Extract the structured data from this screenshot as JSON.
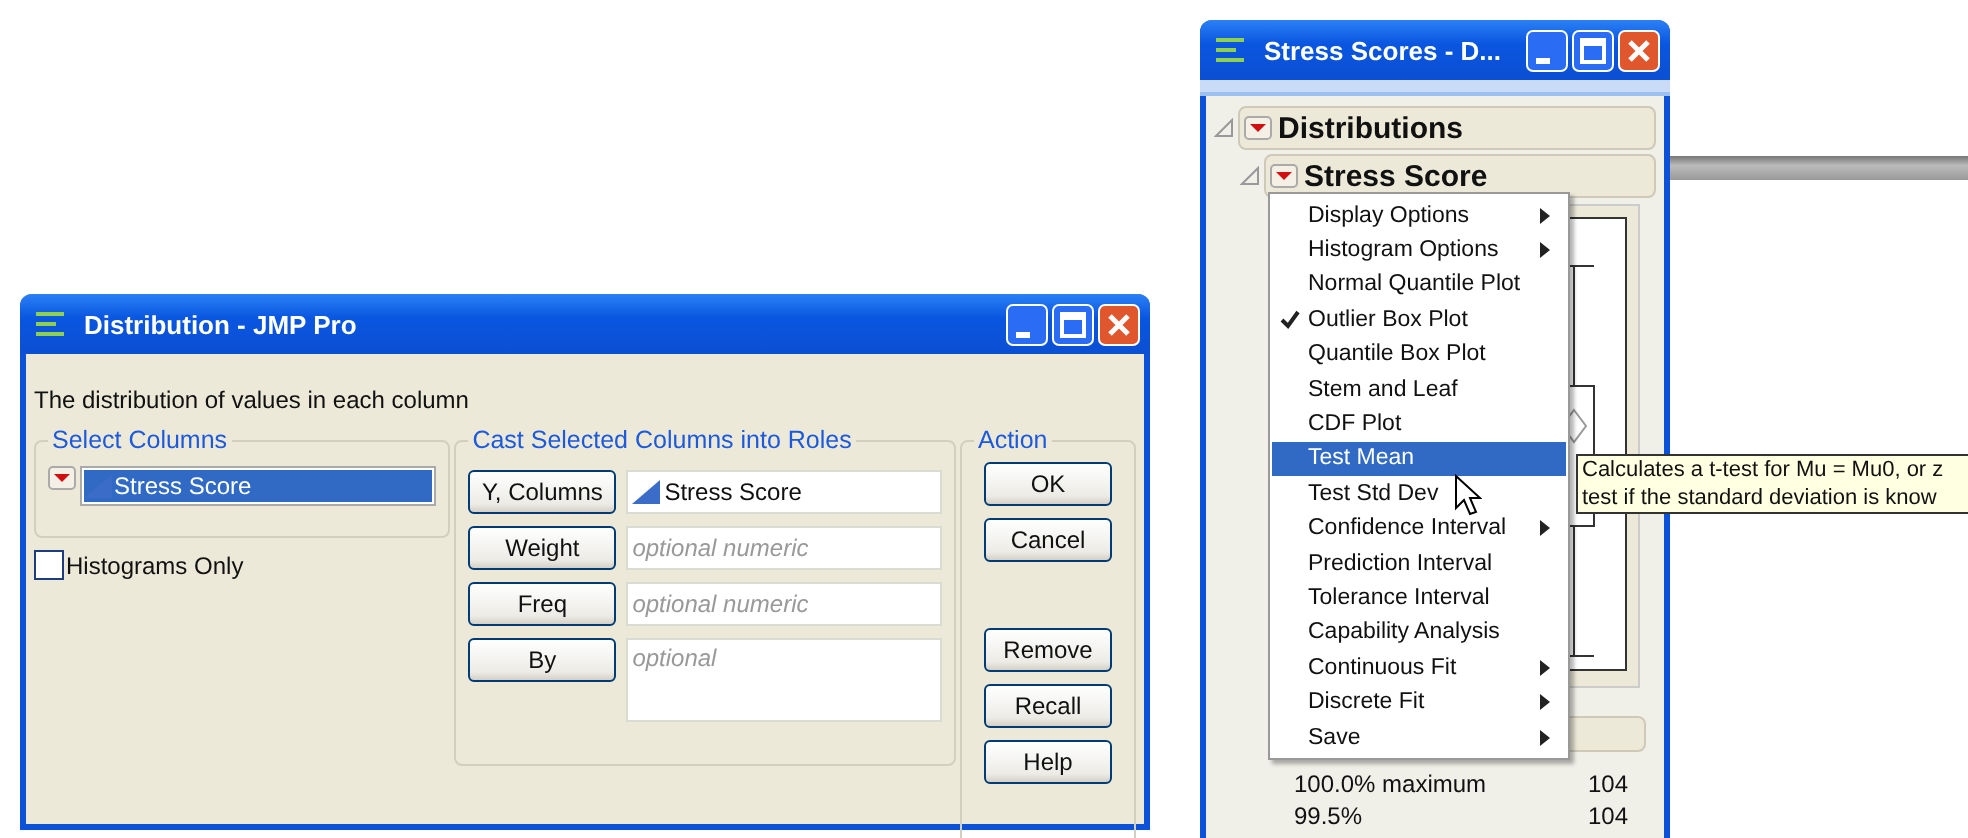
{
  "dialog": {
    "title": "Distribution - JMP Pro",
    "description": "The distribution of values in each column",
    "select_columns": {
      "title": "Select Columns",
      "columns": [
        {
          "name": "Stress Score",
          "selected": true
        }
      ]
    },
    "histograms_only": {
      "label": "Histograms Only",
      "checked": false
    },
    "roles": {
      "title": "Cast Selected Columns into Roles",
      "rows": [
        {
          "button": "Y, Columns",
          "value": "Stress Score",
          "kind": "field"
        },
        {
          "button": "Weight",
          "placeholder": "optional numeric",
          "kind": "field"
        },
        {
          "button": "Freq",
          "placeholder": "optional numeric",
          "kind": "field"
        },
        {
          "button": "By",
          "placeholder": "optional",
          "kind": "list"
        }
      ]
    },
    "action": {
      "title": "Action",
      "buttons_top": [
        "OK",
        "Cancel"
      ],
      "buttons_bottom": [
        "Remove",
        "Recall",
        "Help"
      ]
    }
  },
  "report": {
    "title": "Stress Scores - D...",
    "outline": [
      {
        "title": "Distributions",
        "expanded": true
      },
      {
        "title": "Stress Score",
        "expanded": true
      }
    ],
    "quantiles": [
      {
        "label": "100.0% maximum",
        "value": "104"
      },
      {
        "label": "99.5%",
        "value": "104"
      }
    ]
  },
  "menu": {
    "items": [
      {
        "label": "Display Options",
        "checked": false,
        "submenu": true,
        "selected": false
      },
      {
        "label": "Histogram Options",
        "checked": false,
        "submenu": true,
        "selected": false
      },
      {
        "label": "Normal Quantile Plot",
        "checked": false,
        "submenu": false,
        "selected": false
      },
      {
        "label": "Outlier Box Plot",
        "checked": true,
        "submenu": false,
        "selected": false
      },
      {
        "label": "Quantile Box Plot",
        "checked": false,
        "submenu": false,
        "selected": false
      },
      {
        "label": "Stem and Leaf",
        "checked": false,
        "submenu": false,
        "selected": false
      },
      {
        "label": "CDF Plot",
        "checked": false,
        "submenu": false,
        "selected": false
      },
      {
        "label": "Test Mean",
        "checked": false,
        "submenu": false,
        "selected": true
      },
      {
        "label": "Test Std Dev",
        "checked": false,
        "submenu": false,
        "selected": false
      },
      {
        "label": "Confidence Interval",
        "checked": false,
        "submenu": true,
        "selected": false
      },
      {
        "label": "Prediction Interval",
        "checked": false,
        "submenu": false,
        "selected": false
      },
      {
        "label": "Tolerance Interval",
        "checked": false,
        "submenu": false,
        "selected": false
      },
      {
        "label": "Capability Analysis",
        "checked": false,
        "submenu": false,
        "selected": false
      },
      {
        "label": "Continuous Fit",
        "checked": false,
        "submenu": true,
        "selected": false
      },
      {
        "label": "Discrete Fit",
        "checked": false,
        "submenu": true,
        "selected": false
      },
      {
        "label": "Save",
        "checked": false,
        "submenu": true,
        "selected": false
      }
    ]
  },
  "tooltip": {
    "lines": [
      "Calculates a t-test for Mu = Mu0, or z",
      "test if the standard deviation is know"
    ]
  }
}
